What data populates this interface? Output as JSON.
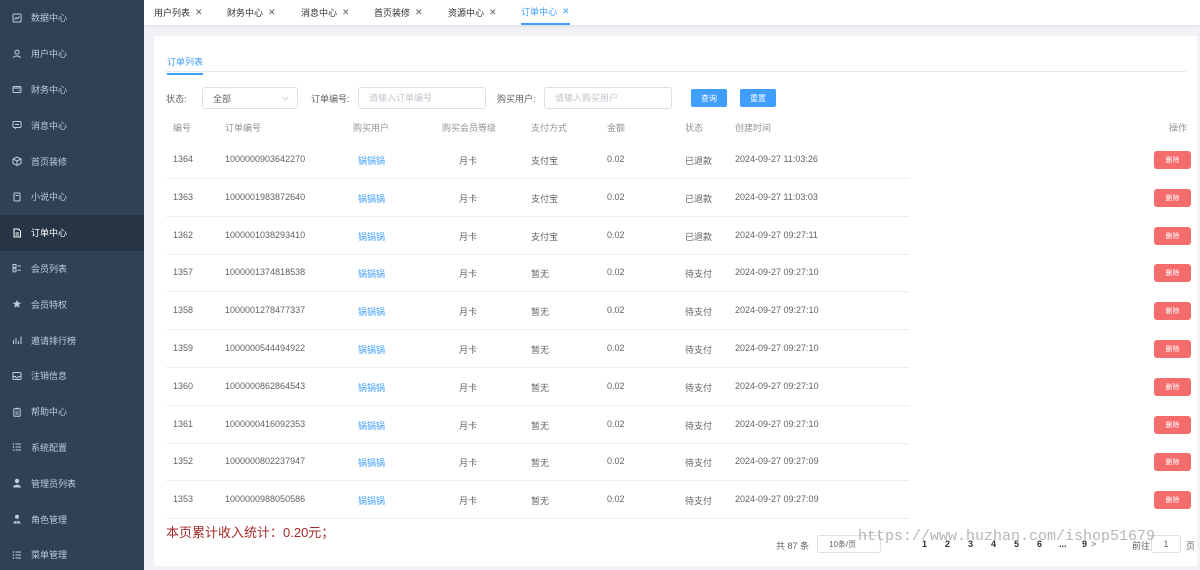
{
  "sidebar": {
    "items": [
      {
        "label": "数据中心",
        "icon": "chart-icon"
      },
      {
        "label": "用户中心",
        "icon": "user-icon"
      },
      {
        "label": "财务中心",
        "icon": "wallet-icon"
      },
      {
        "label": "消息中心",
        "icon": "message-icon"
      },
      {
        "label": "首页装修",
        "icon": "box-icon"
      },
      {
        "label": "小说中心",
        "icon": "book-icon"
      },
      {
        "label": "订单中心",
        "icon": "document-icon",
        "active": true
      },
      {
        "label": "会员列表",
        "icon": "list-icon"
      },
      {
        "label": "会员特权",
        "icon": "star-icon"
      },
      {
        "label": "邀请排行榜",
        "icon": "bar-chart-icon"
      },
      {
        "label": "注销信息",
        "icon": "inbox-icon"
      },
      {
        "label": "帮助中心",
        "icon": "clipboard-icon"
      },
      {
        "label": "系统配置",
        "icon": "menu-icon"
      },
      {
        "label": "管理员列表",
        "icon": "person-icon"
      },
      {
        "label": "角色管理",
        "icon": "role-icon"
      },
      {
        "label": "菜单管理",
        "icon": "menu-icon"
      }
    ]
  },
  "tabs": [
    {
      "label": "用户列表"
    },
    {
      "label": "财务中心"
    },
    {
      "label": "消息中心"
    },
    {
      "label": "首页装修"
    },
    {
      "label": "资源中心"
    },
    {
      "label": "订单中心",
      "active": true
    }
  ],
  "tab_close": "✕",
  "subtab": "订单列表",
  "filters": {
    "status_label": "状态:",
    "status_value": "全部",
    "order_label": "订单编号:",
    "order_placeholder": "请输入订单编号",
    "buyer_label": "购买用户:",
    "buyer_placeholder": "请输入购买用户",
    "query_button": "查询",
    "reset_button": "重置"
  },
  "table": {
    "headers": [
      "编号",
      "订单编号",
      "购买用户",
      "购买会员等级",
      "支付方式",
      "金额",
      "状态",
      "创建时间",
      "操作"
    ],
    "delete_label": "删除",
    "rows": [
      {
        "id": "1364",
        "order_no": "1000000903642270",
        "user": "锅锅锅",
        "level": "月卡",
        "pay": "支付宝",
        "amount": "0.02",
        "status": "已退款",
        "time": "2024-09-27 11:03:26"
      },
      {
        "id": "1363",
        "order_no": "1000001983872640",
        "user": "锅锅锅",
        "level": "月卡",
        "pay": "支付宝",
        "amount": "0.02",
        "status": "已退款",
        "time": "2024-09-27 11:03:03"
      },
      {
        "id": "1362",
        "order_no": "1000001038293410",
        "user": "锅锅锅",
        "level": "月卡",
        "pay": "支付宝",
        "amount": "0.02",
        "status": "已退款",
        "time": "2024-09-27 09:27:11"
      },
      {
        "id": "1357",
        "order_no": "1000001374818538",
        "user": "锅锅锅",
        "level": "月卡",
        "pay": "暂无",
        "amount": "0.02",
        "status": "待支付",
        "time": "2024-09-27 09:27:10"
      },
      {
        "id": "1358",
        "order_no": "1000001278477337",
        "user": "锅锅锅",
        "level": "月卡",
        "pay": "暂无",
        "amount": "0.02",
        "status": "待支付",
        "time": "2024-09-27 09:27:10"
      },
      {
        "id": "1359",
        "order_no": "1000000544494922",
        "user": "锅锅锅",
        "level": "月卡",
        "pay": "暂无",
        "amount": "0.02",
        "status": "待支付",
        "time": "2024-09-27 09:27:10"
      },
      {
        "id": "1360",
        "order_no": "1000000862864543",
        "user": "锅锅锅",
        "level": "月卡",
        "pay": "暂无",
        "amount": "0.02",
        "status": "待支付",
        "time": "2024-09-27 09:27:10"
      },
      {
        "id": "1361",
        "order_no": "1000000416092353",
        "user": "锅锅锅",
        "level": "月卡",
        "pay": "暂无",
        "amount": "0.02",
        "status": "待支付",
        "time": "2024-09-27 09:27:10"
      },
      {
        "id": "1352",
        "order_no": "1000000802237947",
        "user": "锅锅锅",
        "level": "月卡",
        "pay": "暂无",
        "amount": "0.02",
        "status": "待支付",
        "time": "2024-09-27 09:27:09"
      },
      {
        "id": "1353",
        "order_no": "1000000988050586",
        "user": "锅锅锅",
        "level": "月卡",
        "pay": "暂无",
        "amount": "0.02",
        "status": "待支付",
        "time": "2024-09-27 09:27:09"
      }
    ]
  },
  "summary": "本页累计收入统计：0.20元；",
  "pagination": {
    "total": "共 87 条",
    "page_size": "10条/页",
    "pages": [
      "1",
      "2",
      "3",
      "4",
      "5",
      "6",
      "...",
      "9"
    ],
    "next": ">",
    "goto_label": "前往",
    "goto_value": "1",
    "page_unit": "页"
  },
  "watermark": "https://www.huzhan.com/ishop51679"
}
